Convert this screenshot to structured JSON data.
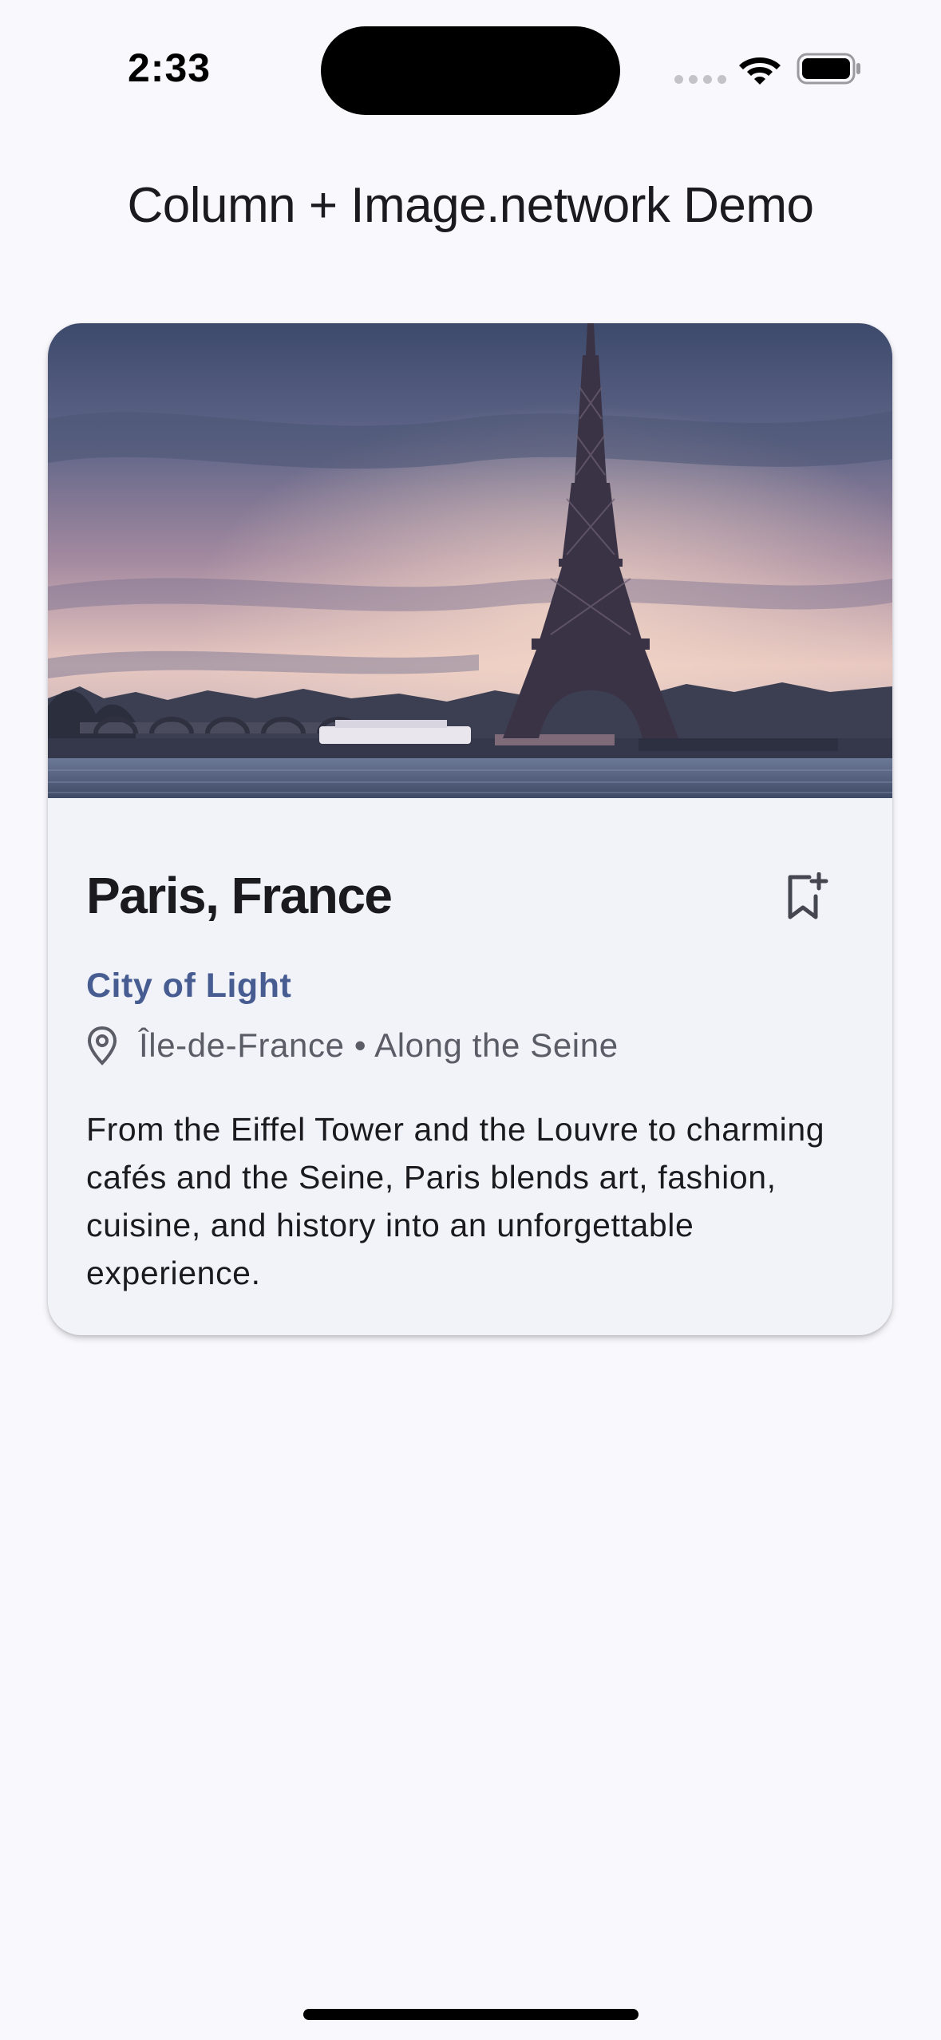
{
  "status_bar": {
    "time": "2:33",
    "icons": [
      "signal-dots-icon",
      "wifi-icon",
      "battery-icon"
    ]
  },
  "app_bar": {
    "title": "Column + Image.network Demo"
  },
  "card": {
    "image_subject": "Eiffel Tower over the Seine at dusk",
    "title": "Paris, France",
    "bookmark_icon": "bookmark-add-icon",
    "subtitle": "City of Light",
    "location_icon": "location-pin-icon",
    "location": "Île-de-France • Along the Seine",
    "description": "From the Eiffel Tower and the Louvre to charming cafés and the Seine, Paris blends art, fashion, cuisine, and history into an unforgettable experience."
  },
  "colors": {
    "background": "#f8f8fd",
    "card_surface": "#f2f3f9",
    "accent": "#475d92",
    "text_primary": "#1b1b1f",
    "text_secondary": "#5a5d66"
  }
}
